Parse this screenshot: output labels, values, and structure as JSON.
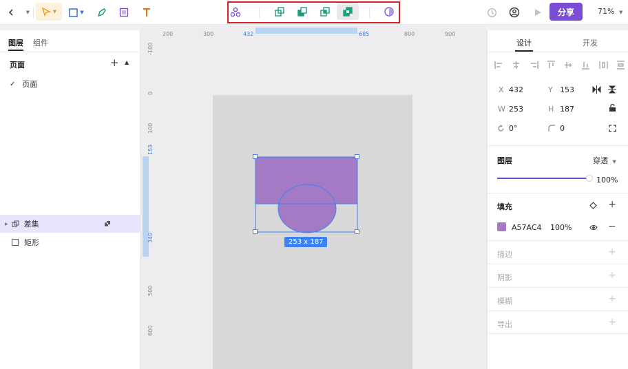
{
  "toolbar": {
    "zoom": "71%",
    "share_label": "分享"
  },
  "left_panel": {
    "tabs": [
      "图层",
      "组件"
    ],
    "pages_title": "页面",
    "pages": [
      "页面"
    ],
    "layers": [
      {
        "name": "差集",
        "selected": true
      },
      {
        "name": "矩形",
        "selected": false
      }
    ]
  },
  "rulers": {
    "top": [
      {
        "label": "200",
        "hl": false
      },
      {
        "label": "300",
        "hl": false
      },
      {
        "label": "432",
        "hl": true
      },
      {
        "label": "685",
        "hl": true
      },
      {
        "label": "800",
        "hl": false
      },
      {
        "label": "900",
        "hl": false
      }
    ],
    "left": [
      {
        "label": "-100",
        "hl": false
      },
      {
        "label": "0",
        "hl": false
      },
      {
        "label": "100",
        "hl": false
      },
      {
        "label": "153",
        "hl": true
      },
      {
        "label": "340",
        "hl": true
      },
      {
        "label": "500",
        "hl": false
      },
      {
        "label": "600",
        "hl": false
      }
    ]
  },
  "canvas": {
    "dimension_badge": "253 x 187",
    "shape_fill": "#A57AC4",
    "selection_color": "#3b82f6"
  },
  "right_panel": {
    "tabs": [
      "设计",
      "开发"
    ],
    "position": {
      "x_label": "X",
      "x": "432",
      "y_label": "Y",
      "y": "153"
    },
    "size": {
      "w_label": "W",
      "w": "253",
      "h_label": "H",
      "h": "187"
    },
    "rotation": "0°",
    "radius": "0",
    "layer_section": {
      "title": "图层",
      "blend": "穿透",
      "opacity": "100%",
      "opacity_fraction": 1.0
    },
    "fill_section": {
      "title": "填充",
      "hex": "A57AC4",
      "opacity": "100%",
      "color": "#A57AC4"
    },
    "stroke_title": "描边",
    "shadow_title": "阴影",
    "blur_title": "模糊",
    "export_title": "导出"
  }
}
